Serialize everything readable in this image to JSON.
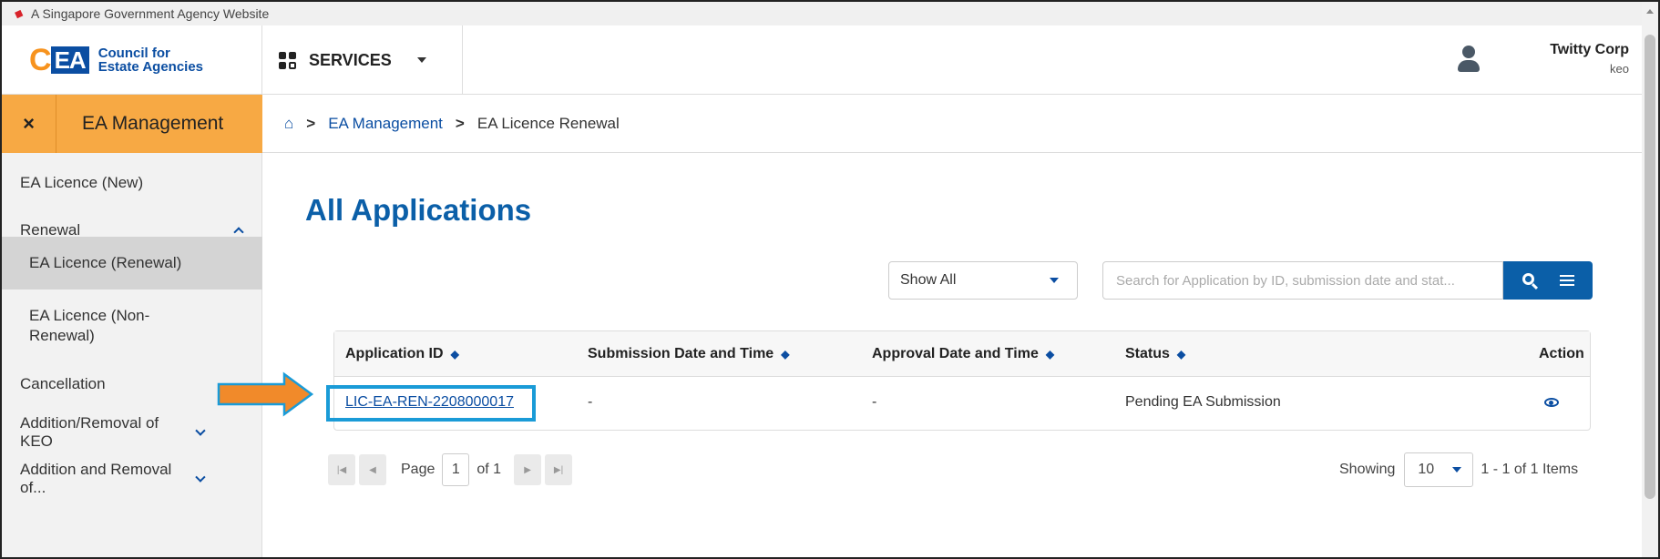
{
  "masthead": {
    "text": "A Singapore Government Agency Website"
  },
  "header": {
    "logo_mark_c": "C",
    "logo_mark_ea": "EA",
    "logo_line1": "Council for",
    "logo_line2": "Estate Agencies",
    "services_label": "SERVICES",
    "user_org": "Twitty Corp",
    "user_role": "keo"
  },
  "sidebar": {
    "close_glyph": "×",
    "title": "EA Management",
    "items": [
      {
        "label": "EA Licence (New)"
      },
      {
        "label": "Renewal"
      },
      {
        "label": "EA Licence (Renewal)"
      },
      {
        "label": "EA Licence (Non-Renewal)"
      },
      {
        "label": "Cancellation"
      },
      {
        "label": "Addition/Removal of KEO"
      },
      {
        "label": "Addition and Removal of..."
      }
    ]
  },
  "breadcrumb": {
    "sep": ">",
    "items": [
      "EA Management",
      "EA Licence Renewal"
    ]
  },
  "main": {
    "title": "All Applications",
    "filter_value": "Show All",
    "search_placeholder": "Search for Application by ID, submission date and stat..."
  },
  "table": {
    "columns": [
      "Application ID",
      "Submission Date and Time",
      "Approval Date and Time",
      "Status",
      "Action"
    ],
    "rows": [
      {
        "id": "LIC-EA-REN-2208000017",
        "submitted": "-",
        "approved": "-",
        "status": "Pending EA Submission"
      }
    ]
  },
  "pager": {
    "page_label": "Page",
    "page": "1",
    "of_label": "of 1",
    "showing_label": "Showing",
    "page_size": "10",
    "range": "1 - 1 of 1 Items"
  },
  "colors": {
    "accent_orange": "#f7a944",
    "brand_blue": "#0b5fa8",
    "highlight_blue": "#1a9bd7",
    "arrow_orange": "#f18a2a"
  }
}
